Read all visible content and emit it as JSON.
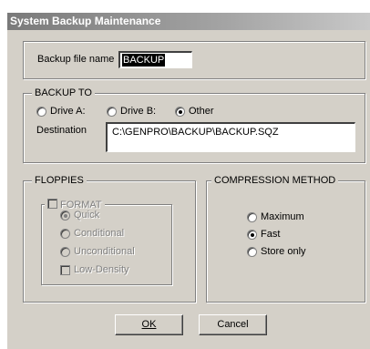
{
  "window": {
    "title": "System Backup Maintenance"
  },
  "file": {
    "label": "Backup file name",
    "value": "BACKUP"
  },
  "backup_to": {
    "legend": "BACKUP TO",
    "options": [
      "Drive A:",
      "Drive B:",
      "Other"
    ],
    "selected": "Other",
    "destination_label": "Destination",
    "destination_value": "C:\\GENPRO\\BACKUP\\BACKUP.SQZ"
  },
  "floppies": {
    "legend": "FLOPPIES",
    "format_label": "FORMAT",
    "options": [
      "Quick",
      "Conditional",
      "Unconditional"
    ],
    "selected": "Quick",
    "low_density_label": "Low-Density",
    "enabled": false
  },
  "compression": {
    "legend": "COMPRESSION METHOD",
    "options": [
      "Maximum",
      "Fast",
      "Store only"
    ],
    "selected": "Fast"
  },
  "buttons": {
    "ok": "OK",
    "cancel": "Cancel"
  }
}
